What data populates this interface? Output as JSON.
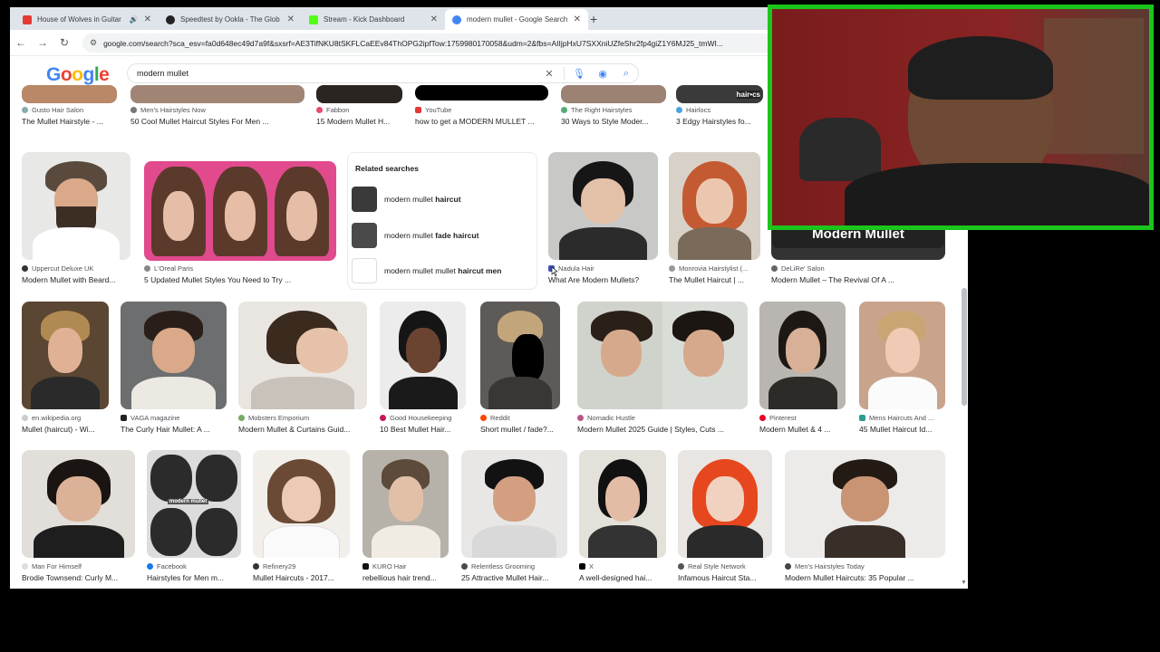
{
  "browser": {
    "tabs": [
      {
        "title": "House of Wolves in Guitar",
        "favicon_color": "#e53935",
        "has_audio": true
      },
      {
        "title": "Speedtest by Ookla - The Glob",
        "favicon_color": "#222222"
      },
      {
        "title": "Stream - Kick Dashboard",
        "favicon_color": "#53fc18"
      },
      {
        "title": "modern mullet - Google Search",
        "favicon_color": "#4285f4",
        "active": true
      }
    ],
    "url": "google.com/search?sca_esv=fa0d648ec49d7a9f&sxsrf=AE3TifNKU8tSKFLCaEEv84ThOPG2ipfTow:1759980170058&udm=2&fbs=AIIjpHxU7SXXniUZfeShr2fp4giZ1Y6MJ25_tmWI..."
  },
  "google": {
    "logo": "Google",
    "query": "modern mullet"
  },
  "rows": {
    "top": [
      {
        "source": "Gusto Hair Salon",
        "caption": "The Mullet Hairstyle - ..."
      },
      {
        "source": "Men's Hairstyles Now",
        "caption": "50 Cool Mullet Haircut Styles For Men ..."
      },
      {
        "source": "Fabbon",
        "caption": "15 Modern Mullet H..."
      },
      {
        "source": "YouTube",
        "caption": "how to get a MODERN MULLET ..."
      },
      {
        "source": "The Right Hairstyles",
        "caption": "30 Ways to Style Moder..."
      },
      {
        "source": "Hairlocs",
        "caption": "3 Edgy Hairstyles fo..."
      }
    ],
    "second": [
      {
        "source": "Uppercut Deluxe UK",
        "caption": "Modern Mullet with Beard..."
      },
      {
        "source": "L'Oreal Paris",
        "caption": "5 Updated Mullet Styles You Need to Try ..."
      },
      {
        "source": "Nadula Hair",
        "caption": "What Are Modern Mullets?"
      },
      {
        "source": "Monrovia Hairstylist (...",
        "caption": "The Mullet Haircut | ..."
      },
      {
        "source": "DeLiRe' Salon",
        "caption": "Modern Mullet – The Revival Of A ..."
      }
    ],
    "third": [
      {
        "source": "en.wikipedia.org",
        "caption": "Mullet (haircut) - Wi..."
      },
      {
        "source": "VAGA magazine",
        "caption": "The Curly Hair Mullet: A ..."
      },
      {
        "source": "Mobsters Emporium",
        "caption": "Modern Mullet & Curtains Guid..."
      },
      {
        "source": "Good Housekeeping",
        "caption": "10 Best Mullet Hair..."
      },
      {
        "source": "Reddit",
        "caption": "Short mullet / fade?..."
      },
      {
        "source": "Nomadic Hustle",
        "caption": "Modern Mullet 2025 Guide | Styles, Cuts ..."
      },
      {
        "source": "Pinterest",
        "caption": "Modern Mullet & 4 ..."
      },
      {
        "source": "Mens Haircuts And ...",
        "caption": "45 Mullet Haircut Id..."
      }
    ],
    "fourth": [
      {
        "source": "Man For Himself",
        "caption": "Brodie Townsend: Curly M..."
      },
      {
        "source": "Facebook",
        "caption": "Hairstyles for Men m..."
      },
      {
        "source": "Refinery29",
        "caption": "Mullet Haircuts - 2017..."
      },
      {
        "source": "KURO Hair",
        "caption": "rebellious hair trend..."
      },
      {
        "source": "Relentless Grooming",
        "caption": "25 Attractive Mullet Hair..."
      },
      {
        "source": "X",
        "caption": "A well-designed hai..."
      },
      {
        "source": "Real Style Network",
        "caption": "Infamous Haircut Sta..."
      },
      {
        "source": "Men's Hairstyles Today",
        "caption": "Modern Mullet Haircuts: 35 Popular ..."
      }
    ]
  },
  "related": {
    "heading": "Related searches",
    "items": [
      {
        "prefix": "modern mullet ",
        "bold": "haircut"
      },
      {
        "prefix": "modern mullet ",
        "bold": "fade haircut"
      },
      {
        "prefix": "modern mullet mullet ",
        "bold": "haircut men"
      }
    ]
  },
  "overlay": {
    "banner": "Modern Mullet"
  },
  "image_labels": {
    "hairlocs_logo": "hair•cs",
    "collage_label": "modern mullet"
  },
  "colors": {
    "webcam_border": "#1cc51c",
    "link_blue": "#1a0dab",
    "tabbar": "#dfe3ea"
  }
}
